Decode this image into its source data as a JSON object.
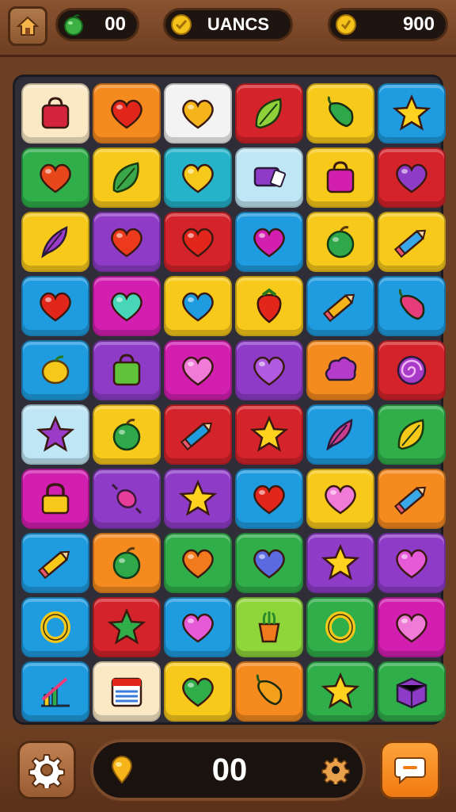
{
  "header": {
    "left_counter": "00",
    "center_label": "UANCS",
    "right_counter": "900"
  },
  "footer": {
    "score": "00"
  },
  "colors": {
    "yellow": "#f7c91a",
    "orange": "#f58a1f",
    "red": "#d4232a",
    "green": "#2fae4a",
    "blue": "#1f9be0",
    "purple": "#8e3cc8",
    "magenta": "#d21fb0",
    "cream": "#fbe9c6",
    "lightblue": "#bfe6f5",
    "lightgreen": "#8ed63a",
    "teal": "#24b3c9",
    "white": "#f3f3f3"
  },
  "board": {
    "rows": [
      [
        [
          "cream",
          "bag",
          "#d4233d"
        ],
        [
          "orange",
          "heart",
          "#e3261c"
        ],
        [
          "white",
          "heart",
          "#f5b51a"
        ],
        [
          "red",
          "leaf",
          "#8fd13a"
        ],
        [
          "yellow",
          "pepper",
          "#2fa84a"
        ],
        [
          "blue",
          "star",
          "#ffd21f"
        ]
      ],
      [
        [
          "green",
          "heart",
          "#e8471c"
        ],
        [
          "yellow",
          "leaf",
          "#3aa84a"
        ],
        [
          "teal",
          "heart",
          "#f5c81a"
        ],
        [
          "lightblue",
          "tag",
          "#8e3cc8"
        ],
        [
          "yellow",
          "bag",
          "#d21fb0"
        ],
        [
          "red",
          "heart",
          "#8e3cc8"
        ]
      ],
      [
        [
          "yellow",
          "feather",
          "#9a3cc8"
        ],
        [
          "purple",
          "heart",
          "#ee3a1c"
        ],
        [
          "red",
          "heart",
          "#e3261c"
        ],
        [
          "blue",
          "heart",
          "#d21fb0"
        ],
        [
          "yellow",
          "apple",
          "#2fa84a"
        ],
        [
          "yellow",
          "pencil",
          "#3aa8e8"
        ]
      ],
      [
        [
          "blue",
          "heart",
          "#e3261c"
        ],
        [
          "magenta",
          "heart",
          "#48d6b8"
        ],
        [
          "yellow",
          "heart",
          "#1f9be0"
        ],
        [
          "yellow",
          "strawberry",
          "#e3261c"
        ],
        [
          "blue",
          "pencil",
          "#f5b51a"
        ],
        [
          "blue",
          "pepper",
          "#e63c7a"
        ]
      ],
      [
        [
          "blue",
          "lemon",
          "#f5c81a"
        ],
        [
          "purple",
          "bag",
          "#5ec23a"
        ],
        [
          "magenta",
          "heart",
          "#f07ad8"
        ],
        [
          "purple",
          "heart",
          "#b05ae0"
        ],
        [
          "orange",
          "cloud",
          "#b43cc8"
        ],
        [
          "red",
          "swirl",
          "#a83cc8"
        ]
      ],
      [
        [
          "lightblue",
          "star",
          "#9a3cc8"
        ],
        [
          "yellow",
          "apple",
          "#2fa84a"
        ],
        [
          "red",
          "pencil",
          "#1f9be0"
        ],
        [
          "red",
          "star",
          "#ffd21f"
        ],
        [
          "blue",
          "feather",
          "#c83c8e"
        ],
        [
          "green",
          "leaf",
          "#f5c81a"
        ]
      ],
      [
        [
          "magenta",
          "lock",
          "#f5c81a"
        ],
        [
          "purple",
          "candy",
          "#e63c9a"
        ],
        [
          "purple",
          "star",
          "#ffd21f"
        ],
        [
          "blue",
          "heart",
          "#e3261c"
        ],
        [
          "yellow",
          "heart",
          "#f07ad8"
        ],
        [
          "orange",
          "pencil",
          "#3aa8e8"
        ]
      ],
      [
        [
          "blue",
          "pencil",
          "#f5c81a"
        ],
        [
          "orange",
          "apple",
          "#2fa84a"
        ],
        [
          "green",
          "heart",
          "#f07a1c"
        ],
        [
          "green",
          "heart",
          "#5a6ae0"
        ],
        [
          "purple",
          "star",
          "#ffd21f"
        ],
        [
          "purple",
          "heart",
          "#e65ad8"
        ]
      ],
      [
        [
          "blue",
          "ring",
          "#f5c81a"
        ],
        [
          "red",
          "star",
          "#2fae4a"
        ],
        [
          "blue",
          "heart",
          "#e65ad8"
        ],
        [
          "lightgreen",
          "pot",
          "#f07a1c"
        ],
        [
          "green",
          "ring",
          "#f5c81a"
        ],
        [
          "magenta",
          "heart",
          "#f07ad8"
        ]
      ],
      [
        [
          "blue",
          "chart",
          "#e63c7a"
        ],
        [
          "cream",
          "calendar",
          "#3a7ad8"
        ],
        [
          "yellow",
          "heart",
          "#2fae4a"
        ],
        [
          "orange",
          "pepper",
          "#f5a01a"
        ],
        [
          "green",
          "star",
          "#ffd21f"
        ],
        [
          "green",
          "box",
          "#8e3cc8"
        ]
      ]
    ]
  }
}
